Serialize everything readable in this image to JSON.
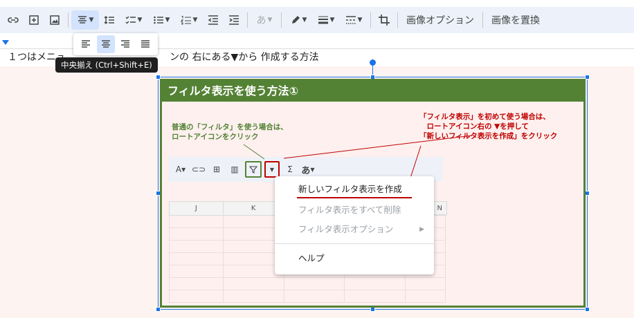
{
  "toolbar": {
    "text_style_label": "あ",
    "image_options_label": "画像オプション",
    "replace_image_label": "画像を置換"
  },
  "align_popup": {
    "tooltip": "中央揃え (Ctrl+Shift+E)"
  },
  "document": {
    "line_start": "１つはメニュ",
    "line_end": "ンの 右にある▼から 作成する方法"
  },
  "image": {
    "header": "フィルタ表示を使う方法①",
    "note_green": "普通の「フィルタ」を使う場合は、\nロートアイコンをクリック",
    "note_red": "「フィルタ表示」を初めて使う場合は、\n　ロートアイコン右の ▼を押して\n「新しいフィルタ表示を作成」をクリック",
    "sheet_toolbar_text": "あ",
    "columns": [
      "J",
      "K",
      "",
      "",
      "N"
    ],
    "menu": {
      "items": [
        {
          "label": "新しいフィルタ表示を作成",
          "disabled": false
        },
        {
          "label": "フィルタ表示をすべて削除",
          "disabled": true
        },
        {
          "label": "フィルタ表示オプション",
          "disabled": true,
          "submenu": true
        },
        {
          "label": "ヘルプ",
          "disabled": false
        }
      ]
    }
  },
  "colors": {
    "accent": "#1a73e8",
    "green": "#548235",
    "red": "#c00000"
  }
}
